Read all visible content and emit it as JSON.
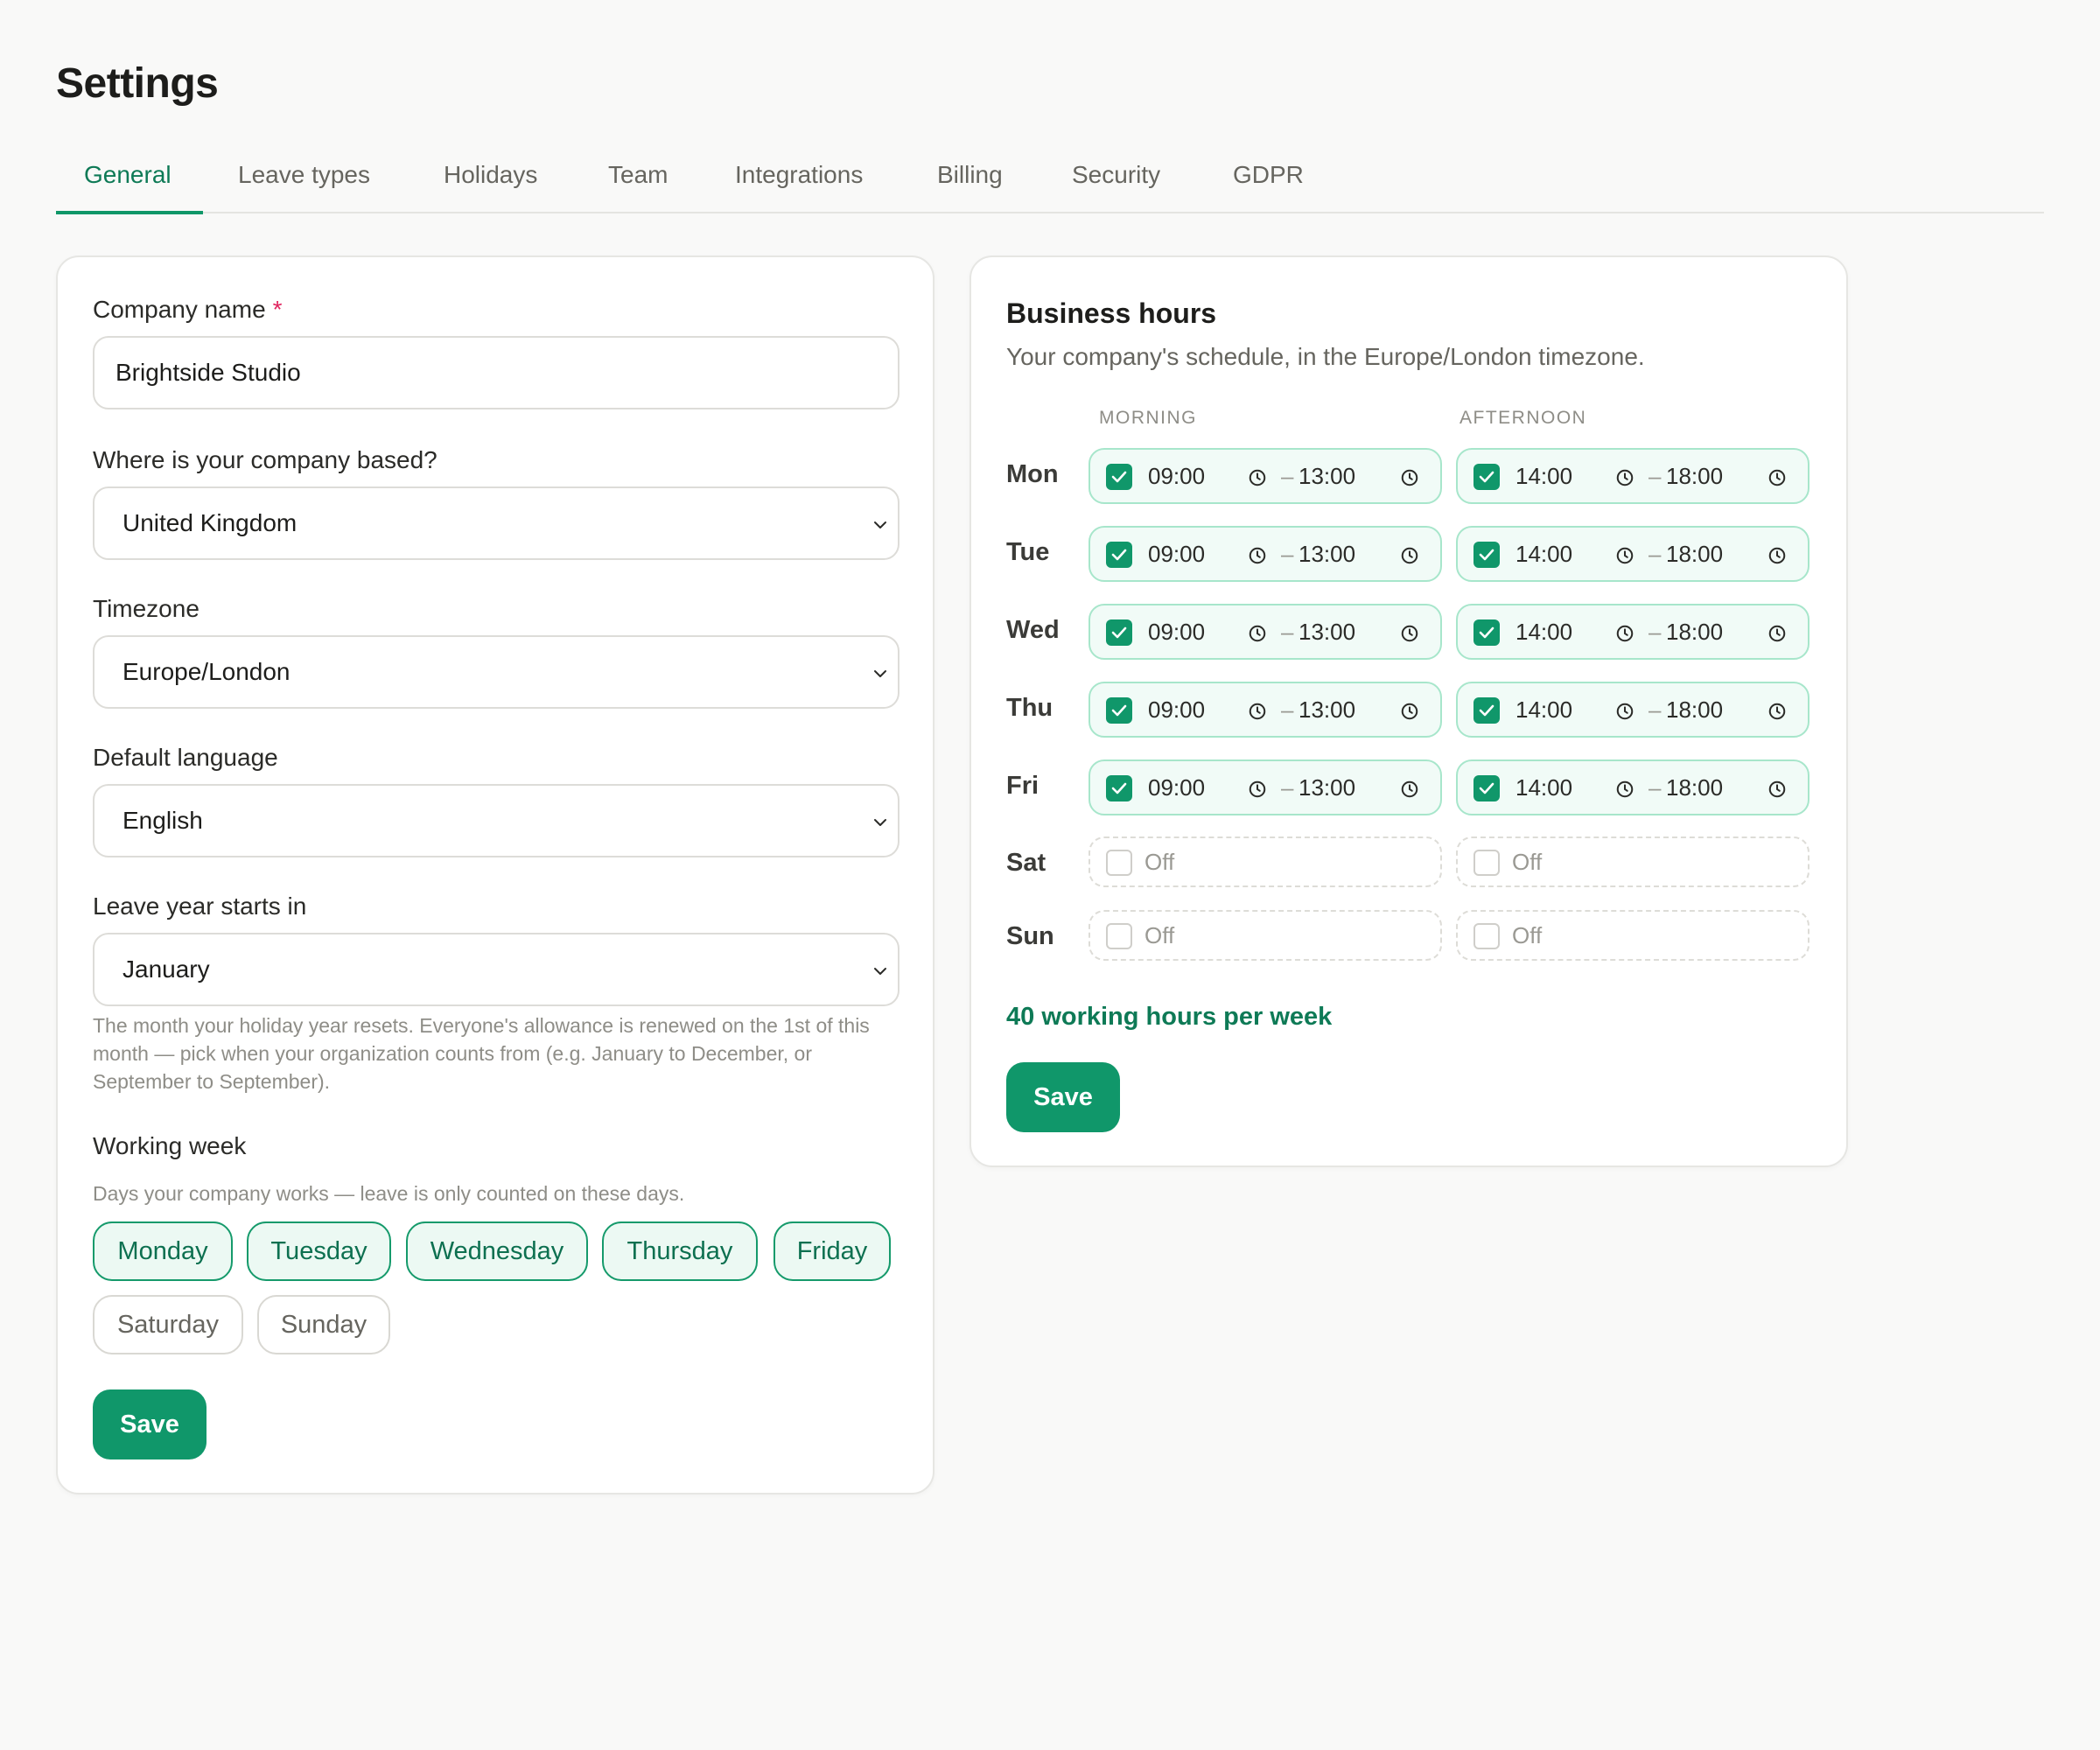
{
  "page": {
    "title": "Settings"
  },
  "tabs": [
    {
      "label": "General",
      "active": true
    },
    {
      "label": "Leave types"
    },
    {
      "label": "Holidays"
    },
    {
      "label": "Team"
    },
    {
      "label": "Integrations"
    },
    {
      "label": "Billing"
    },
    {
      "label": "Security"
    },
    {
      "label": "GDPR"
    }
  ],
  "general": {
    "company_name_label": "Company name",
    "required_mark": "*",
    "company_name_value": "Brightside Studio",
    "country_label": "Where is your company based?",
    "country_value": "United Kingdom",
    "timezone_label": "Timezone",
    "timezone_value": "Europe/London",
    "language_label": "Default language",
    "language_value": "English",
    "leave_year_label": "Leave year starts in",
    "leave_year_value": "January",
    "leave_year_help": "The month your holiday year resets. Everyone's allowance is renewed on the 1st of this month — pick when your organization counts from (e.g. January to December, or September to September).",
    "working_week_label": "Working week",
    "working_week_help": "Days your company works — leave is only counted on these days.",
    "days": [
      {
        "label": "Monday",
        "selected": true
      },
      {
        "label": "Tuesday",
        "selected": true
      },
      {
        "label": "Wednesday",
        "selected": true
      },
      {
        "label": "Thursday",
        "selected": true
      },
      {
        "label": "Friday",
        "selected": true
      },
      {
        "label": "Saturday",
        "selected": false
      },
      {
        "label": "Sunday",
        "selected": false
      }
    ],
    "save_label": "Save"
  },
  "business_hours": {
    "title": "Business hours",
    "subtitle": "Your company's schedule, in the Europe/London timezone.",
    "morning_label": "MORNING",
    "afternoon_label": "AFTERNOON",
    "separator": "–",
    "off_label": "Off",
    "rows": [
      {
        "day": "Mon",
        "morning": {
          "enabled": true,
          "start": "09:00",
          "end": "13:00"
        },
        "afternoon": {
          "enabled": true,
          "start": "14:00",
          "end": "18:00"
        }
      },
      {
        "day": "Tue",
        "morning": {
          "enabled": true,
          "start": "09:00",
          "end": "13:00"
        },
        "afternoon": {
          "enabled": true,
          "start": "14:00",
          "end": "18:00"
        }
      },
      {
        "day": "Wed",
        "morning": {
          "enabled": true,
          "start": "09:00",
          "end": "13:00"
        },
        "afternoon": {
          "enabled": true,
          "start": "14:00",
          "end": "18:00"
        }
      },
      {
        "day": "Thu",
        "morning": {
          "enabled": true,
          "start": "09:00",
          "end": "13:00"
        },
        "afternoon": {
          "enabled": true,
          "start": "14:00",
          "end": "18:00"
        }
      },
      {
        "day": "Fri",
        "morning": {
          "enabled": true,
          "start": "09:00",
          "end": "13:00"
        },
        "afternoon": {
          "enabled": true,
          "start": "14:00",
          "end": "18:00"
        }
      },
      {
        "day": "Sat",
        "morning": {
          "enabled": false
        },
        "afternoon": {
          "enabled": false
        }
      },
      {
        "day": "Sun",
        "morning": {
          "enabled": false
        },
        "afternoon": {
          "enabled": false
        }
      }
    ],
    "total": "40 working hours per week",
    "save_label": "Save"
  },
  "colors": {
    "accent": "#10976a",
    "accent_text": "#0e7a56",
    "chip_bg": "#ecf9f3",
    "slot_border": "#a7e6cb",
    "required": "#e0245e"
  },
  "icons": {
    "select_indicator": "chevron-down-icon",
    "time": "clock-icon",
    "checked": "check-icon"
  }
}
